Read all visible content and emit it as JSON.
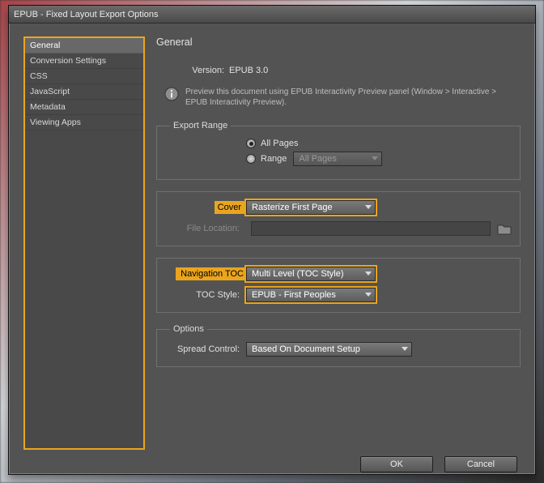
{
  "window": {
    "title": "EPUB - Fixed Layout Export Options"
  },
  "sidebar": {
    "items": [
      {
        "label": "General",
        "active": true
      },
      {
        "label": "Conversion Settings",
        "active": false
      },
      {
        "label": "CSS",
        "active": false
      },
      {
        "label": "JavaScript",
        "active": false
      },
      {
        "label": "Metadata",
        "active": false
      },
      {
        "label": "Viewing Apps",
        "active": false
      }
    ]
  },
  "panel": {
    "heading": "General",
    "version_label": "Version:",
    "version_value": "EPUB 3.0",
    "preview_hint": "Preview this document using EPUB Interactivity Preview panel (Window > Interactive > EPUB Interactivity Preview).",
    "export_range": {
      "legend": "Export Range",
      "all_pages": "All Pages",
      "range": "Range",
      "range_value": "All Pages",
      "selected": "all"
    },
    "cover": {
      "label": "Cover",
      "value": "Rasterize First Page"
    },
    "file_location": {
      "label": "File Location:"
    },
    "nav_toc": {
      "label": "Navigation TOC",
      "value": "Multi Level (TOC Style)"
    },
    "toc_style": {
      "label": "TOC Style:",
      "value": "EPUB - First Peoples"
    },
    "options": {
      "legend": "Options",
      "spread_control_label": "Spread Control:",
      "spread_control_value": "Based On Document Setup"
    }
  },
  "buttons": {
    "ok": "OK",
    "cancel": "Cancel"
  }
}
